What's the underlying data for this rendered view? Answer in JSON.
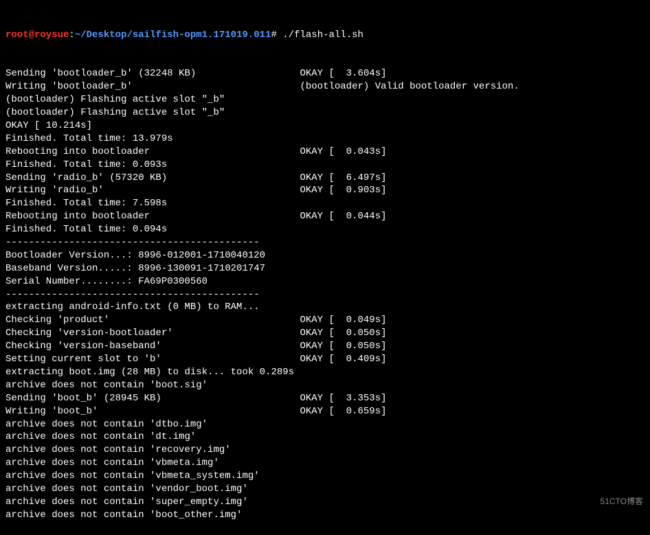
{
  "prompt": {
    "user": "root@roysue",
    "colon": ":",
    "path": "~/Desktop/sailfish-opm1.171019.011",
    "hash": "#",
    "command": "./flash-all.sh"
  },
  "lines": [
    {
      "left": "Sending 'bootloader_b' (32248 KB)",
      "right": "OKAY [  3.604s]"
    },
    {
      "left": "Writing 'bootloader_b'",
      "right": "(bootloader) Valid bootloader version."
    },
    {
      "left": "(bootloader) Flashing active slot \"_b\"",
      "right": ""
    },
    {
      "left": "(bootloader) Flashing active slot \"_b\"",
      "right": ""
    },
    {
      "left": "OKAY [ 10.214s]",
      "right": ""
    },
    {
      "left": "Finished. Total time: 13.979s",
      "right": ""
    },
    {
      "left": "Rebooting into bootloader",
      "right": "OKAY [  0.043s]"
    },
    {
      "left": "Finished. Total time: 0.093s",
      "right": ""
    },
    {
      "left": "Sending 'radio_b' (57320 KB)",
      "right": "OKAY [  6.497s]"
    },
    {
      "left": "Writing 'radio_b'",
      "right": "OKAY [  0.903s]"
    },
    {
      "left": "Finished. Total time: 7.598s",
      "right": ""
    },
    {
      "left": "Rebooting into bootloader",
      "right": "OKAY [  0.044s]"
    },
    {
      "left": "Finished. Total time: 0.094s",
      "right": ""
    },
    {
      "left": "--------------------------------------------",
      "right": ""
    },
    {
      "left": "Bootloader Version...: 8996-012001-1710040120",
      "right": ""
    },
    {
      "left": "Baseband Version.....: 8996-130091-1710201747",
      "right": ""
    },
    {
      "left": "Serial Number........: FA69P0300560",
      "right": ""
    },
    {
      "left": "--------------------------------------------",
      "right": ""
    },
    {
      "left": "extracting android-info.txt (0 MB) to RAM...",
      "right": ""
    },
    {
      "left": "Checking 'product'",
      "right": "OKAY [  0.049s]"
    },
    {
      "left": "Checking 'version-bootloader'",
      "right": "OKAY [  0.050s]"
    },
    {
      "left": "Checking 'version-baseband'",
      "right": "OKAY [  0.050s]"
    },
    {
      "left": "Setting current slot to 'b'",
      "right": "OKAY [  0.409s]"
    },
    {
      "left": "extracting boot.img (28 MB) to disk... took 0.289s",
      "right": ""
    },
    {
      "left": "archive does not contain 'boot.sig'",
      "right": ""
    },
    {
      "left": "Sending 'boot_b' (28945 KB)",
      "right": "OKAY [  3.353s]"
    },
    {
      "left": "Writing 'boot_b'",
      "right": "OKAY [  0.659s]"
    },
    {
      "left": "archive does not contain 'dtbo.img'",
      "right": ""
    },
    {
      "left": "archive does not contain 'dt.img'",
      "right": ""
    },
    {
      "left": "archive does not contain 'recovery.img'",
      "right": ""
    },
    {
      "left": "archive does not contain 'vbmeta.img'",
      "right": ""
    },
    {
      "left": "archive does not contain 'vbmeta_system.img'",
      "right": ""
    },
    {
      "left": "archive does not contain 'vendor_boot.img'",
      "right": ""
    },
    {
      "left": "archive does not contain 'super_empty.img'",
      "right": ""
    },
    {
      "left": "archive does not contain 'boot_other.img'",
      "right": ""
    }
  ],
  "watermark": "51CTO博客",
  "layout": {
    "rightColStart": 51
  }
}
